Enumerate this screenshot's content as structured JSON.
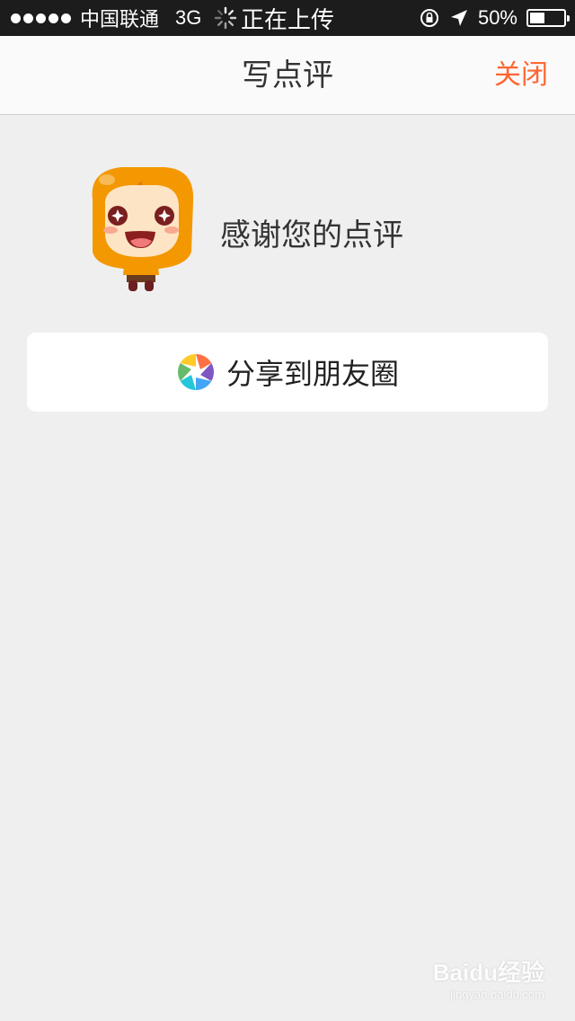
{
  "status_bar": {
    "carrier": "中国联通",
    "network": "3G",
    "activity": "正在上传",
    "battery": "50%",
    "battery_level": 0.5,
    "icons": [
      "signal-dots-icon",
      "loading-spinner-icon",
      "rotation-lock-icon",
      "location-arrow-icon",
      "battery-icon"
    ]
  },
  "nav": {
    "title": "写点评",
    "close_label": "关闭"
  },
  "main": {
    "thanks_text": "感谢您的点评",
    "mascot_icon": "mascot-icon",
    "share_label": "分享到朋友圈",
    "share_icon": "moments-aperture-icon"
  },
  "watermark": {
    "logo": "Baidu经验",
    "url": "jingyan.baidu.com"
  },
  "colors": {
    "accent": "#ff6633",
    "background": "#efefef",
    "status_bar": "#1c1c1c",
    "mascot_orange": "#f39800"
  }
}
